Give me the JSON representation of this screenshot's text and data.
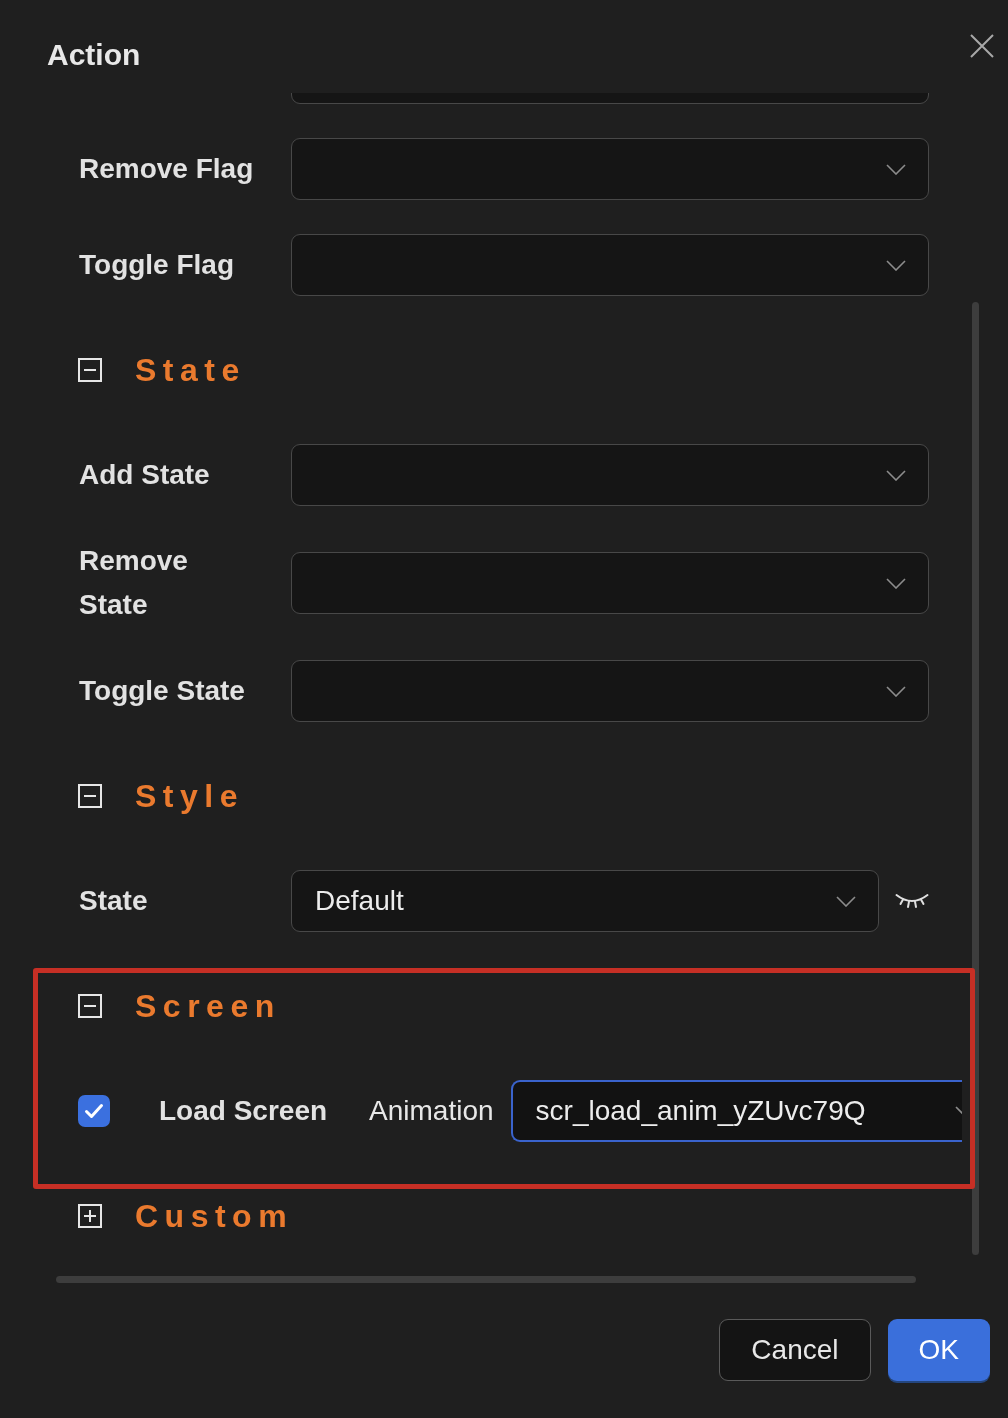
{
  "dialog": {
    "title": "Action"
  },
  "fields": [
    {
      "kind": "select"
    },
    {
      "kind": "select",
      "label": "Remove Flag"
    },
    {
      "kind": "select",
      "label": "Toggle Flag"
    }
  ],
  "sections": [
    {
      "title": "State",
      "expanded": true,
      "highlighted": false,
      "fields": [
        {
          "kind": "select",
          "label": "Add State"
        },
        {
          "kind": "select",
          "label": "Remove State"
        },
        {
          "kind": "select",
          "label": "Toggle State"
        }
      ]
    },
    {
      "title": "Style",
      "expanded": true,
      "highlighted": false,
      "fields": [
        {
          "kind": "select",
          "label": "State",
          "value": "Default",
          "hidden": true
        }
      ]
    },
    {
      "title": "Screen",
      "expanded": true,
      "highlighted": true,
      "fields": [
        {
          "kind": "checkbox",
          "label": "Load Screen",
          "checked": true,
          "sublabel": "Animation",
          "value": "scr_load_anim_yZUvc79Q",
          "focused": true
        }
      ]
    },
    {
      "title": "Custom",
      "expanded": false,
      "highlighted": false
    }
  ],
  "buttons": [
    {
      "label": "Cancel",
      "primary": false
    },
    {
      "label": "OK",
      "primary": true
    }
  ]
}
